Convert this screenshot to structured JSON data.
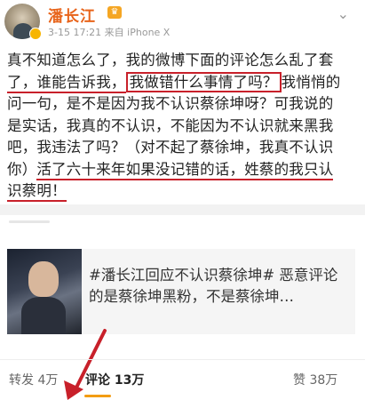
{
  "post": {
    "author": "潘长江",
    "time": "3-15 17:21",
    "source_prefix": "来自",
    "device": "iPhone X",
    "lines": [
      "真不知道怎么了，我的微博下面的评论怎么乱了套",
      "了，谁能告诉我，",
      "我做错什么事情了吗？",
      "我悄悄的",
      "问一句，是不是因为我不认识蔡徐坤呀？可我说的",
      "是实话，我真的不认识，不能因为不认识就来黑我",
      "吧，我违法了吗？（对不起了蔡徐坤，我真不认识",
      "你）",
      "活了六十来年如果没记错的话，姓蔡的我只认",
      "识蔡明！"
    ]
  },
  "repost_card": {
    "text": "#潘长江回应不认识蔡徐坤# 恶意评论的是蔡徐坤黑粉，不是蔡徐坤…"
  },
  "tabs": {
    "repost": "转发 4万",
    "comment_label": "评论",
    "comment_count": "13万",
    "like": "赞 38万"
  },
  "colors": {
    "username": "#e8641b",
    "highlight_red": "#c8202a",
    "tab_underline": "#f39c12"
  }
}
